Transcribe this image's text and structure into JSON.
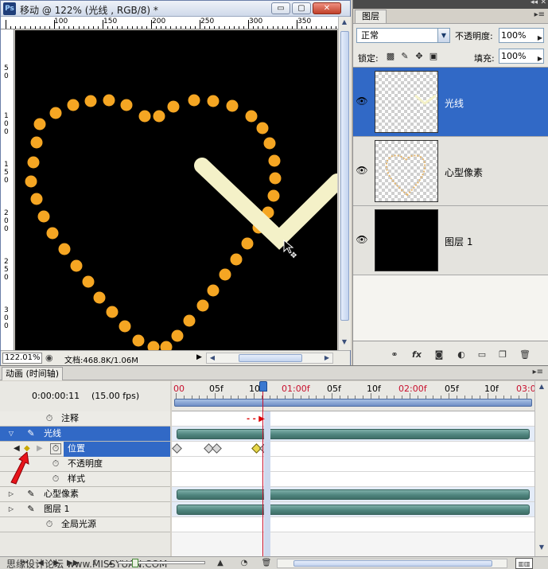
{
  "document": {
    "title": "移动 @ 122% (光线 , RGB/8) *",
    "app_icon": "Ps",
    "zoom": "122.01%",
    "info": "文档:468.8K/1.06M",
    "ruler_top": [
      "100",
      "150",
      "200",
      "250",
      "300",
      "350"
    ],
    "ruler_left": [
      "5",
      "0",
      "1",
      "0",
      "0",
      "1",
      "5",
      "0",
      "2",
      "0",
      "0",
      "2",
      "5",
      "0",
      "3",
      "0",
      "0"
    ],
    "window_buttons": {
      "minimize": "▭",
      "maximize": "▢",
      "close": "✕"
    }
  },
  "layers_panel": {
    "tab": "图层",
    "menu_icon": "▸≡",
    "blend_mode": "正常",
    "opacity_label": "不透明度:",
    "opacity_value": "100%",
    "lock_label": "锁定:",
    "fill_label": "填充:",
    "fill_value": "100%",
    "layers": [
      {
        "name": "光线",
        "selected": true,
        "visible": true
      },
      {
        "name": "心型像素",
        "selected": false,
        "visible": true
      },
      {
        "name": "图层 1",
        "selected": false,
        "visible": true
      }
    ],
    "footer_icons": [
      "link-icon",
      "fx-icon",
      "mask-icon",
      "adjustment-icon",
      "group-icon",
      "new-layer-icon",
      "trash-icon"
    ]
  },
  "animation": {
    "tab": "动画 (时间轴)",
    "timecode": "0:00:00:11",
    "fps": "(15.00 fps)",
    "ruler_labels": [
      {
        "text": "00",
        "red": true
      },
      {
        "text": "05f",
        "red": false
      },
      {
        "text": "10f",
        "red": false
      },
      {
        "text": "01:00f",
        "red": true
      },
      {
        "text": "05f",
        "red": false
      },
      {
        "text": "10f",
        "red": false
      },
      {
        "text": "02:00f",
        "red": true
      },
      {
        "text": "05f",
        "red": false
      },
      {
        "text": "10f",
        "red": false
      },
      {
        "text": "03:0",
        "red": true
      }
    ],
    "tracks": [
      {
        "label": "注释",
        "kind": "property"
      },
      {
        "label": "光线",
        "kind": "layer",
        "expanded": true,
        "selected": true
      },
      {
        "label": "位置",
        "kind": "property",
        "selected": true,
        "keyframes": true
      },
      {
        "label": "不透明度",
        "kind": "property"
      },
      {
        "label": "样式",
        "kind": "property"
      },
      {
        "label": "心型像素",
        "kind": "layer"
      },
      {
        "label": "图层 1",
        "kind": "layer"
      },
      {
        "label": "全局光源",
        "kind": "property"
      }
    ],
    "keyframes_position": [
      0,
      4,
      5,
      10,
      11
    ]
  },
  "watermark": "思缘设计论坛 www.MISSYUAN.COM",
  "colors": {
    "accent": "#3169c6",
    "track_bar": "#4f857e",
    "playhead": "#c8102e",
    "dots": "#f5a623",
    "light_stroke": "#f4f1c8"
  }
}
